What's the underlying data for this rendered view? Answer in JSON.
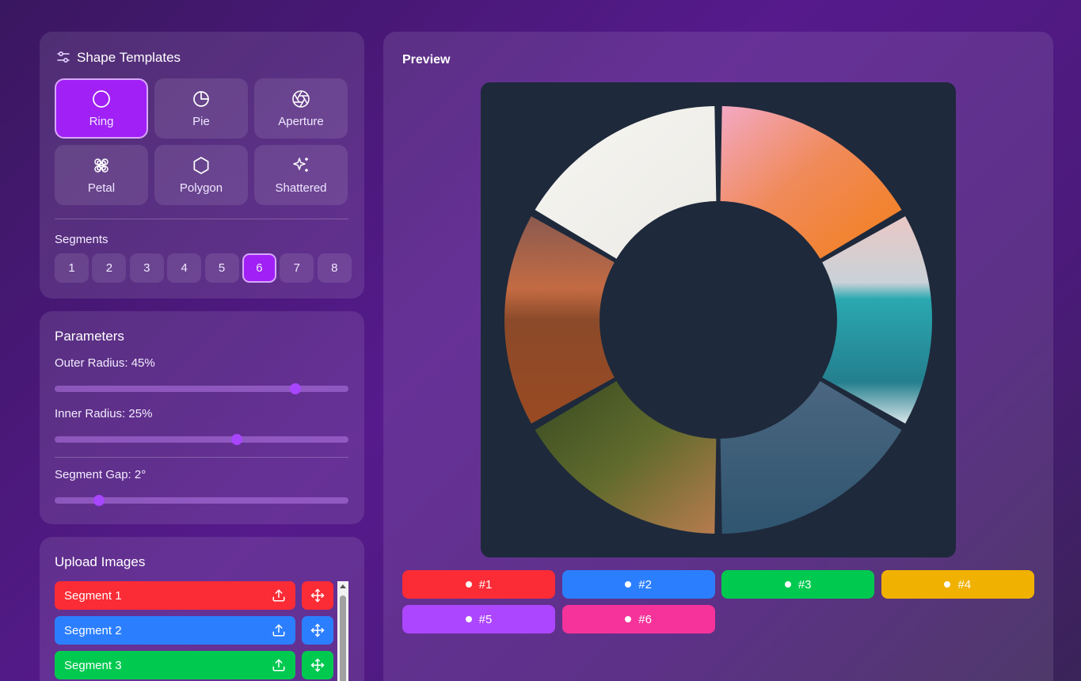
{
  "templates": {
    "title": "Shape Templates",
    "items": [
      {
        "label": "Ring",
        "icon": "circle-icon",
        "active": true
      },
      {
        "label": "Pie",
        "icon": "pie-chart-icon",
        "active": false
      },
      {
        "label": "Aperture",
        "icon": "aperture-icon",
        "active": false
      },
      {
        "label": "Petal",
        "icon": "flower-icon",
        "active": false
      },
      {
        "label": "Polygon",
        "icon": "hexagon-icon",
        "active": false
      },
      {
        "label": "Shattered",
        "icon": "sparkles-icon",
        "active": false
      }
    ],
    "segments_label": "Segments",
    "segments": [
      "1",
      "2",
      "3",
      "4",
      "5",
      "6",
      "7",
      "8"
    ],
    "segments_selected": "6"
  },
  "parameters": {
    "title": "Parameters",
    "outer_radius_label": "Outer Radius: 45%",
    "outer_radius_level": 0.82,
    "inner_radius_label": "Inner Radius: 25%",
    "inner_radius_level": 0.62,
    "gap_label": "Segment Gap: 2°",
    "gap_level": 0.15
  },
  "upload": {
    "title": "Upload Images",
    "rows": [
      {
        "label": "Segment 1",
        "color": "#fb2c36"
      },
      {
        "label": "Segment 2",
        "color": "#2b7fff"
      },
      {
        "label": "Segment 3",
        "color": "#00c950"
      }
    ]
  },
  "preview": {
    "title": "Preview",
    "canvas_bg": "#1e293b",
    "chips": [
      {
        "label": "#1",
        "color": "#fb2c36"
      },
      {
        "label": "#2",
        "color": "#2b7fff"
      },
      {
        "label": "#3",
        "color": "#00c950"
      },
      {
        "label": "#4",
        "color": "#f0b100"
      },
      {
        "label": "#5",
        "color": "#ad46ff"
      },
      {
        "label": "#6",
        "color": "#f6339a"
      }
    ]
  }
}
